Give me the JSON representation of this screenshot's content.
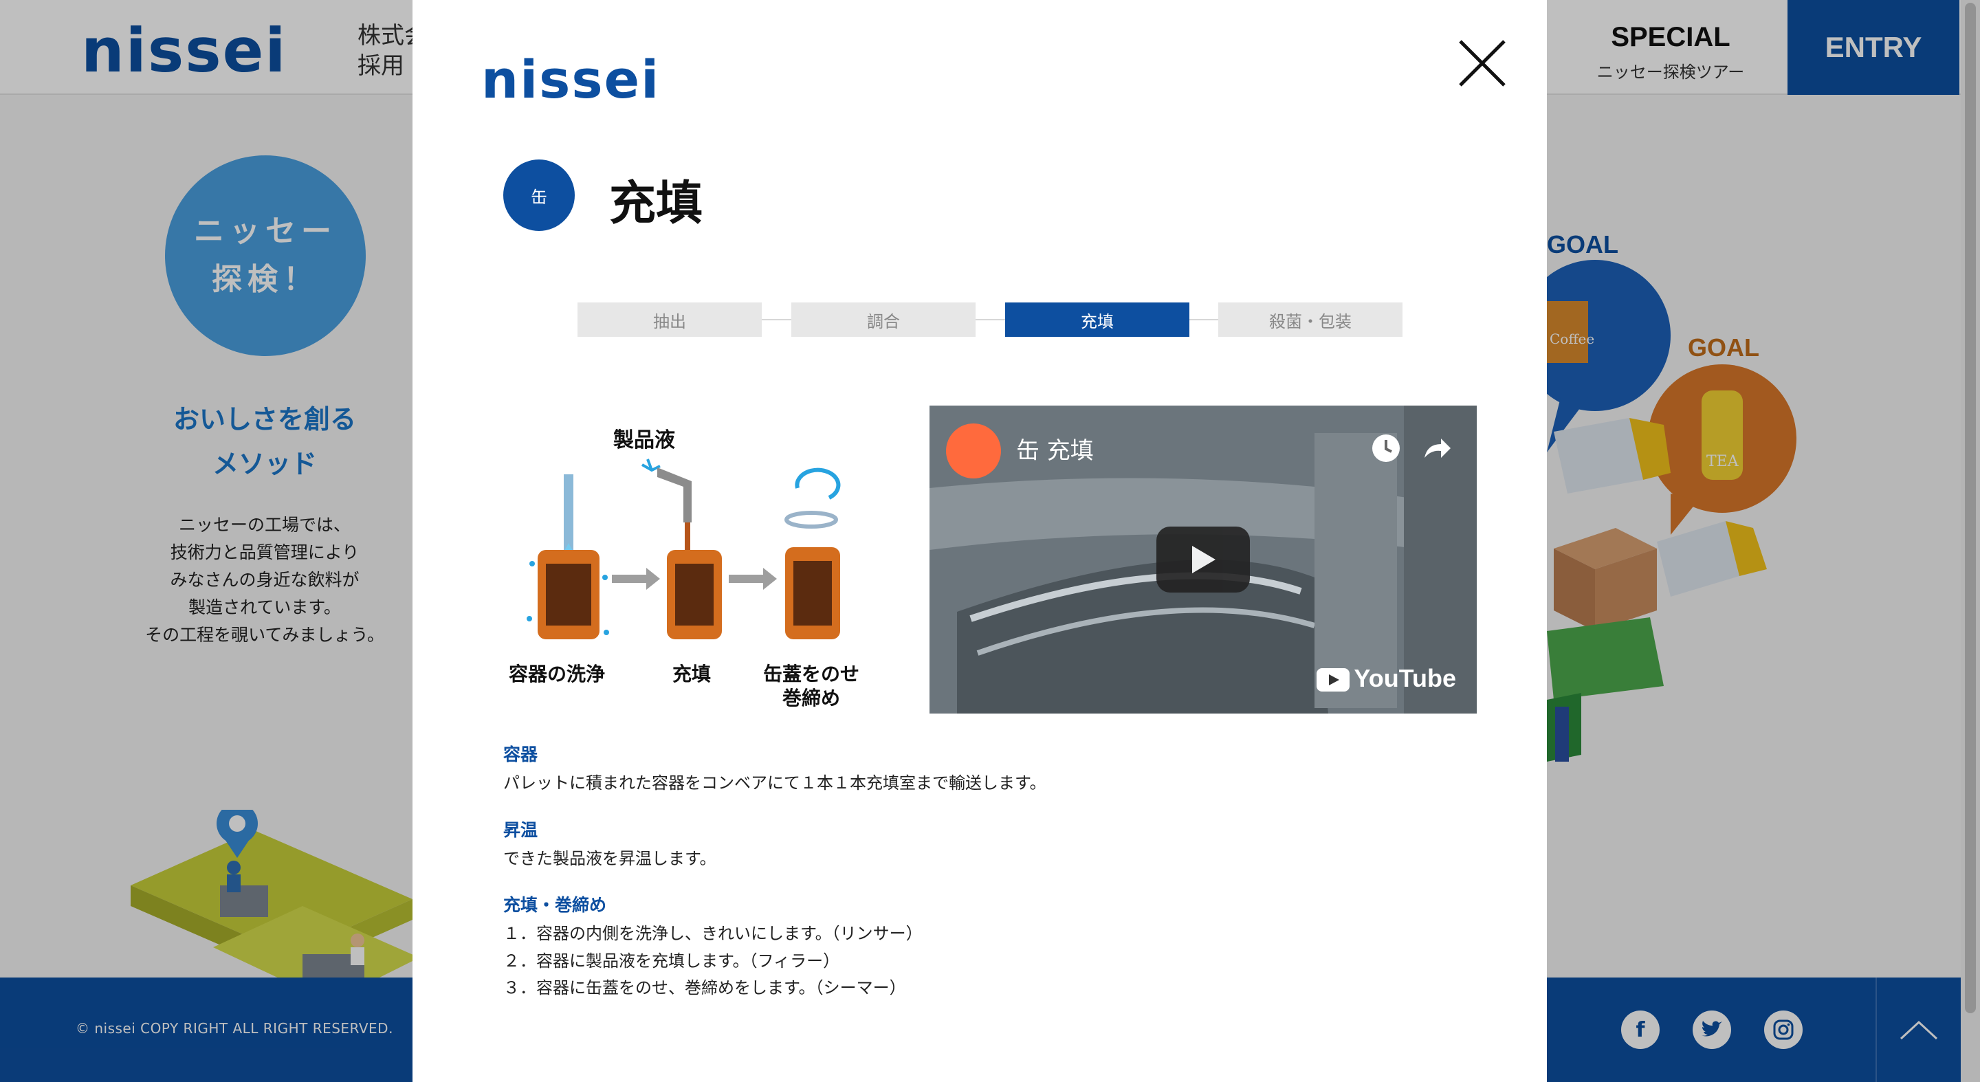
{
  "header": {
    "logo": "nissei",
    "company_line1": "株式会",
    "company_line2": "採用",
    "special_title": "SPECIAL",
    "special_sub": "ニッセー探検ツアー",
    "entry": "ENTRY"
  },
  "left": {
    "badge_line1": "ニッセー",
    "badge_line2": "探検！",
    "method_line1": "おいしさを創る",
    "method_line2": "メソッド",
    "desc": [
      "ニッセーの工場では、",
      "技術力と品質管理により",
      "みなさんの身近な飲料が",
      "製造されています。",
      "その工程を覗いてみましょう。"
    ]
  },
  "right": {
    "goal1": "GOAL",
    "goal2": "GOAL",
    "coffee": "Coffee",
    "tea": "TEA"
  },
  "footer": {
    "copyright": "© nissei COPY RIGHT ALL RIGHT RESERVED.",
    "social": [
      "facebook-icon",
      "twitter-icon",
      "instagram-icon"
    ]
  },
  "modal": {
    "logo": "nissei",
    "badge": "缶",
    "title": "充填",
    "tabs": [
      "抽出",
      "調合",
      "充填",
      "殺菌・包装"
    ],
    "active_tab": 2,
    "illustration": {
      "label_liquid": "製品液",
      "step1": "容器の洗浄",
      "step2": "充填",
      "step3_line1": "缶蓋をのせ",
      "step3_line2": "巻締め"
    },
    "video": {
      "title": "缶 充填",
      "brand": "YouTube"
    },
    "sections": [
      {
        "heading": "容器",
        "text": "パレットに積まれた容器をコンベアにて１本１本充填室まで輸送します。"
      },
      {
        "heading": "昇温",
        "text": "できた製品液を昇温します。"
      },
      {
        "heading": "充填・巻締め",
        "items": [
          "１．容器の内側を洗浄し、きれいにします。（リンサー）",
          "２．容器に製品液を充填します。（フィラー）",
          "３．容器に缶蓋をのせ、巻締めをします。（シーマー）"
        ]
      }
    ]
  },
  "colors": {
    "brand": "#0d4fa0",
    "accent_light": "#4a9fdf",
    "tab_inactive": "#e7e7e7"
  }
}
